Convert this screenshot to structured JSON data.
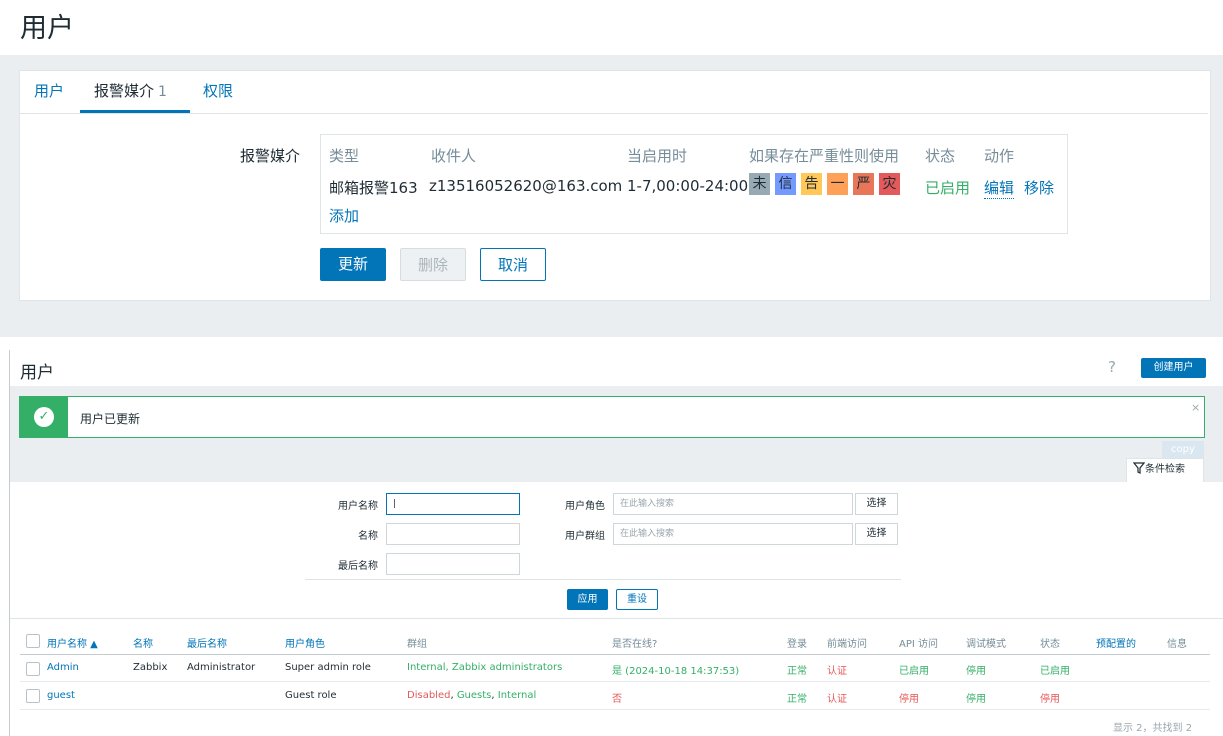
{
  "top": {
    "title": "用户",
    "tabs": [
      {
        "label": "用户"
      },
      {
        "label": "报警媒介",
        "count": "1"
      },
      {
        "label": "权限"
      }
    ],
    "media_label": "报警媒介",
    "media_headers": [
      "类型",
      "收件人",
      "当启用时",
      "如果存在严重性则使用",
      "状态",
      "动作"
    ],
    "media_row": {
      "type": "邮箱报警163",
      "recipient": "z13516052620@163.com",
      "when_active": "1-7,00:00-24:00",
      "severities": [
        {
          "label": "未",
          "color": "#97aab3"
        },
        {
          "label": "信",
          "color": "#7499ff"
        },
        {
          "label": "告",
          "color": "#ffc859"
        },
        {
          "label": "一",
          "color": "#ffa059"
        },
        {
          "label": "严",
          "color": "#e97659"
        },
        {
          "label": "灾",
          "color": "#e45959"
        }
      ],
      "status": "已启用",
      "edit": "编辑",
      "remove": "移除"
    },
    "add_link": "添加",
    "buttons": {
      "update": "更新",
      "delete": "删除",
      "cancel": "取消"
    }
  },
  "bottom": {
    "title": "用户",
    "help": "?",
    "create_button": "创建用户",
    "message": "用户已更新",
    "close": "×",
    "copy": "copy",
    "filter_tab": "条件检索",
    "filter": {
      "username_label": "用户名称",
      "name_label": "名称",
      "lastname_label": "最后名称",
      "role_label": "用户角色",
      "group_label": "用户群组",
      "role_placeholder": "在此输入搜索",
      "group_placeholder": "在此输入搜索",
      "select": "选择",
      "apply": "应用",
      "reset": "重设"
    },
    "columns": [
      "用户名称 ▲",
      "名称",
      "最后名称",
      "用户角色",
      "群组",
      "是否在线?",
      "登录",
      "前端访问",
      "API 访问",
      "调试模式",
      "状态",
      "预配置的",
      "信息"
    ],
    "rows": [
      {
        "username": "Admin",
        "name": "Zabbix",
        "lastname": "Administrator",
        "role": "Super admin role",
        "groups": "Internal, Zabbix administrators",
        "online": "是 (2024-10-18 14:37:53)",
        "login": "正常",
        "frontend": "认证",
        "api": "已启用",
        "debug": "停用",
        "status": "已启用"
      },
      {
        "username": "guest",
        "name": "",
        "lastname": "",
        "role": "Guest role",
        "groups_disabled": "Disabled",
        "groups_sep1": ", ",
        "groups_guests": "Guests",
        "groups_sep2": ", ",
        "groups_internal": "Internal",
        "online": "否",
        "login": "正常",
        "frontend": "认证",
        "api": "停用",
        "debug": "停用",
        "status": "停用"
      }
    ],
    "footer": "显示 2，共找到 2"
  }
}
